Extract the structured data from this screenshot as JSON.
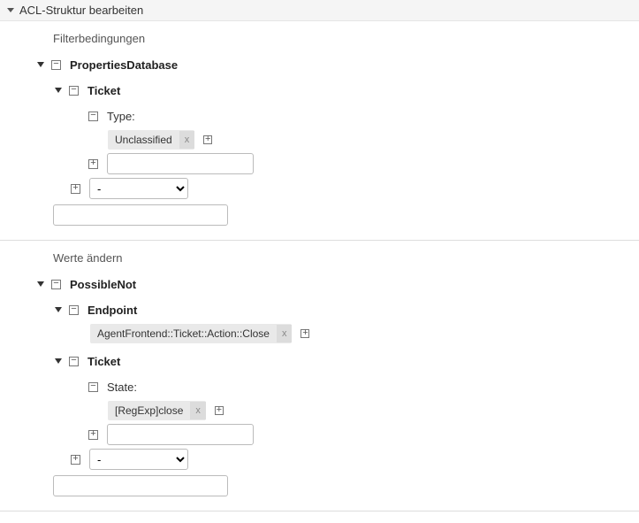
{
  "header": {
    "title": "ACL-Struktur bearbeiten"
  },
  "filter": {
    "heading": "Filterbedingungen",
    "prop_db": "PropertiesDatabase",
    "ticket": "Ticket",
    "type_label": "Type:",
    "type_tag": "Unclassified",
    "select_default": "-",
    "input_value": "",
    "free_value": ""
  },
  "change": {
    "heading": "Werte ändern",
    "possible_not": "PossibleNot",
    "endpoint": "Endpoint",
    "endpoint_tag": "AgentFrontend::Ticket::Action::Close",
    "ticket": "Ticket",
    "state_label": "State:",
    "state_tag": "[RegExp]close",
    "select_default": "-",
    "input_value": "",
    "free_value": ""
  }
}
